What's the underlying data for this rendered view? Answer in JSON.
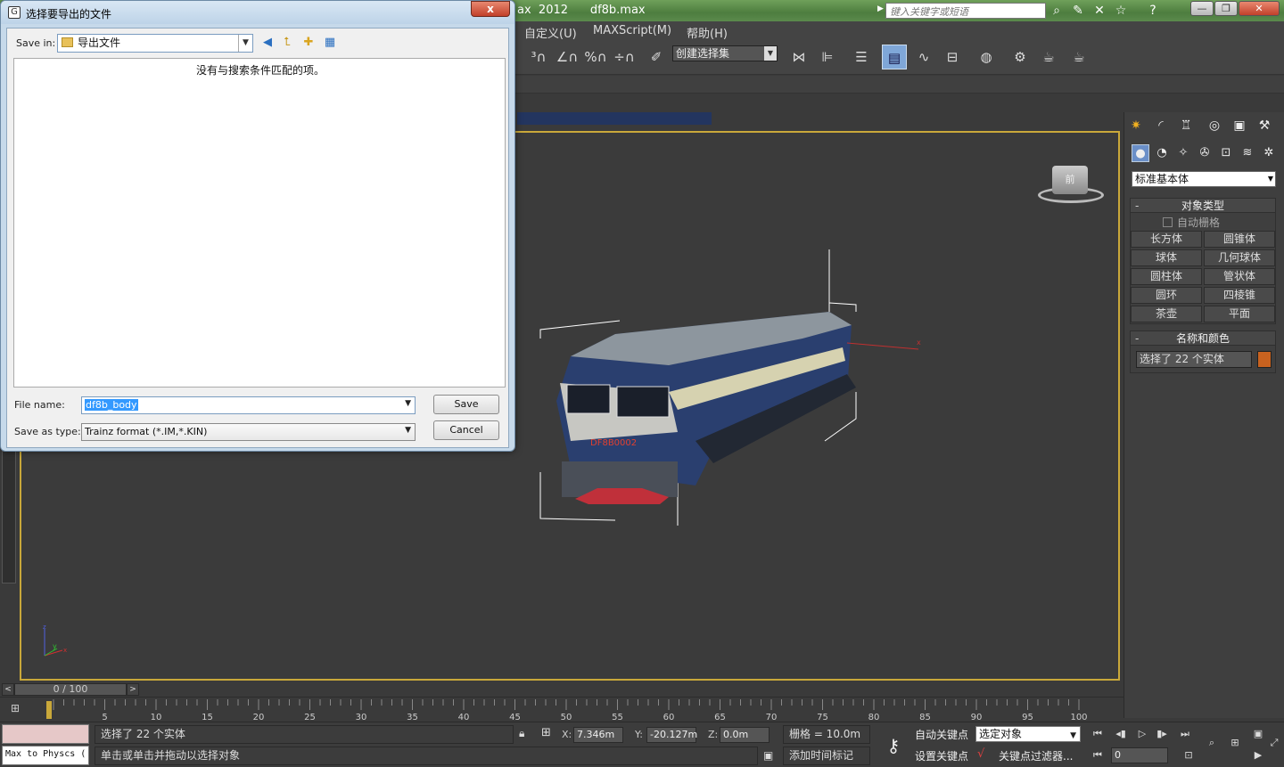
{
  "app": {
    "title_fragment": "ax  2012",
    "file_name": "df8b.max",
    "search_placeholder": "键入关键字或短语"
  },
  "menu": [
    "自定义(U)",
    "MAXScript(M)",
    "帮助(H)"
  ],
  "toolbar": {
    "selection_set": "创建选择集"
  },
  "viewport": {
    "viewcube_label": "前",
    "locomotive_number": "DF8B0002"
  },
  "command_panel": {
    "category": "标准基本体",
    "object_type": {
      "title": "对象类型",
      "autogrid": "自动栅格",
      "buttons": [
        "长方体",
        "圆锥体",
        "球体",
        "几何球体",
        "圆柱体",
        "管状体",
        "圆环",
        "四棱锥",
        "茶壶",
        "平面"
      ]
    },
    "name_color": {
      "title": "名称和颜色",
      "name_value": "选择了 22 个实体",
      "color": "#c8621f"
    }
  },
  "time_slider": {
    "position": "0 / 100",
    "prev": "<",
    "next": ">"
  },
  "trackbar": {
    "ticks": [
      "5",
      "10",
      "15",
      "20",
      "25",
      "30",
      "35",
      "40",
      "45",
      "50",
      "55",
      "60",
      "65",
      "70",
      "75",
      "80",
      "85",
      "90",
      "95",
      "100"
    ]
  },
  "status": {
    "listener_text": "Max to Physcs (",
    "selection_info": "选择了 22 个实体",
    "prompt": "单击或单击并拖动以选择对象",
    "x_label": "X:",
    "x_value": "7.346m",
    "y_label": "Y:",
    "y_value": "-20.127m",
    "z_label": "Z:",
    "z_value": "0.0m",
    "grid": "栅格 = 10.0m",
    "add_time_tag": "添加时间标记",
    "auto_key": "自动关键点",
    "set_key": "设置关键点",
    "key_mode": "选定对象",
    "key_filters": "关键点过滤器...",
    "current_frame": "0"
  },
  "dialog": {
    "title": "选择要导出的文件",
    "close": "x",
    "save_in_label": "Save in:",
    "save_in_value": "导出文件",
    "empty_message": "没有与搜索条件匹配的项。",
    "file_name_label": "File name:",
    "file_name_value": "df8b_body",
    "save_as_type_label": "Save as type:",
    "save_as_type_value": "Trainz format (*.IM,*.KIN)",
    "save_button": "Save",
    "cancel_button": "Cancel"
  }
}
